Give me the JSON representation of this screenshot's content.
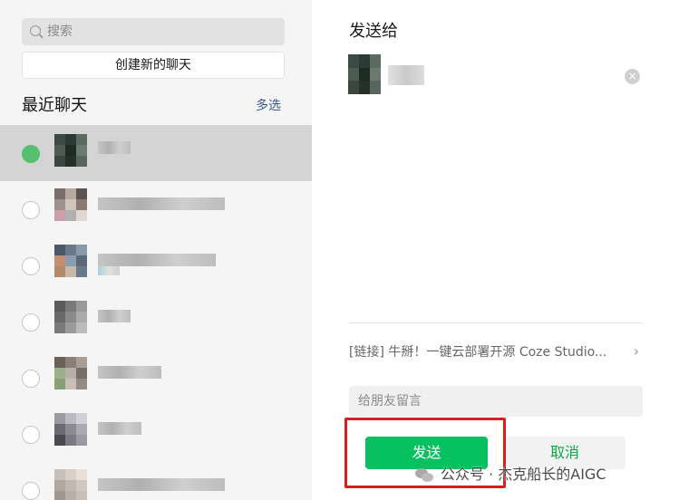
{
  "left_panel": {
    "search_placeholder": "搜索",
    "create_chat_label": "创建新的聊天",
    "recent_title": "最近聊天",
    "multi_select_label": "多选",
    "chats": [
      {
        "selected": true,
        "avatar_colors": [
          "#3c4a44",
          "#2b3a35",
          "#5a6b5f",
          "#4d5c52",
          "#1f2a26",
          "#6b7a70",
          "#3a4740",
          "#25302b",
          "#59665e"
        ]
      },
      {
        "selected": false,
        "avatar_colors": [
          "#7a6f6a",
          "#b8a8a0",
          "#5c5450",
          "#a09090",
          "#d0c4bc",
          "#8a7a72",
          "#c9a0a8",
          "#b0b0b0",
          "#e0d8d2"
        ]
      },
      {
        "selected": false,
        "avatar_colors": [
          "#4a5868",
          "#6a7888",
          "#8a98a8",
          "#c29070",
          "#8a9cb0",
          "#5a6878",
          "#b08a6a",
          "#c8b8a8",
          "#6a7a8a"
        ]
      },
      {
        "selected": false,
        "avatar_colors": [
          "#5a5a5a",
          "#7a7a7a",
          "#9a9a9a",
          "#6a6a6a",
          "#8a8a8a",
          "#aaaaaa",
          "#7a7a7a",
          "#9a9a9a",
          "#bbbbbb"
        ]
      },
      {
        "selected": false,
        "avatar_colors": [
          "#6a6058",
          "#8a8078",
          "#a89e96",
          "#9cb08c",
          "#b8b0a8",
          "#786e66",
          "#88a078",
          "#c8c0b8",
          "#948a82"
        ]
      },
      {
        "selected": false,
        "avatar_colors": [
          "#9a9aa0",
          "#babac0",
          "#d0d0d6",
          "#6a6a70",
          "#8a8a90",
          "#aaaab0",
          "#4a4a50",
          "#7a7a80",
          "#9a9aa0"
        ]
      },
      {
        "selected": false,
        "avatar_colors": [
          "#c8c0b8",
          "#d8d0c8",
          "#e8e0d8",
          "#b0a8a0",
          "#c0b8b0",
          "#d0c8c0",
          "#a09890",
          "#b8b0a8",
          "#c8c0b8"
        ]
      }
    ]
  },
  "right_panel": {
    "send_to_title": "发送给",
    "recipient_avatar_colors": [
      "#3c4a44",
      "#2b3a35",
      "#5a6b5f",
      "#4d5c52",
      "#1f2a26",
      "#6b7a70",
      "#3a4740",
      "#25302b",
      "#59665e"
    ],
    "remove_icon": "×",
    "link_preview": "[链接] 牛掰！一键云部署开源 Coze Studio...",
    "link_chevron": "›",
    "message_placeholder": "给朋友留言",
    "send_label": "发送",
    "cancel_label": "取消"
  },
  "watermark": {
    "text": "公众号 · 杰克船长的AIGC"
  },
  "colors": {
    "accent_green": "#07c160",
    "highlight_red": "#e01b1b",
    "link_blue": "#3a5a86"
  }
}
